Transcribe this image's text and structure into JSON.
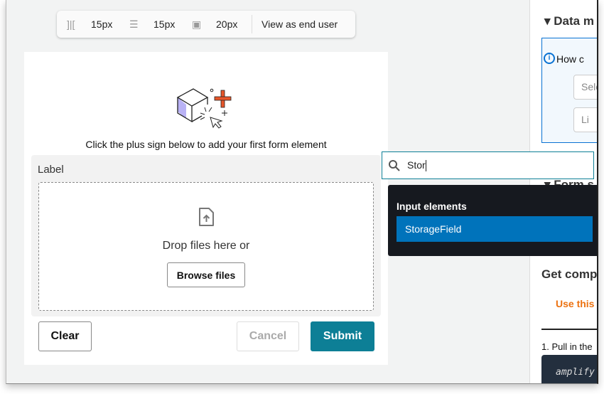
{
  "toolbar": {
    "items": [
      {
        "icon": "horizontal-gap-icon",
        "value": "15px"
      },
      {
        "icon": "vertical-gap-icon",
        "value": "15px"
      },
      {
        "icon": "padding-icon",
        "value": "20px"
      }
    ],
    "view_label": "View as end user"
  },
  "canvas": {
    "hint": "Click the plus sign below to add your first form element",
    "field": {
      "label": "Label",
      "drop_text": "Drop files here or",
      "browse_label": "Browse files"
    },
    "actions": {
      "clear": "Clear",
      "cancel": "Cancel",
      "submit": "Submit"
    }
  },
  "search": {
    "value": "Stor"
  },
  "menu": {
    "group": "Input elements",
    "options": [
      "StorageField"
    ]
  },
  "right_panel": {
    "data_heading": "Data m",
    "info_question": "How c",
    "select_placeholder": "Sele",
    "link_button": "Li",
    "form_heading": "Form s",
    "get_heading": "Get comp",
    "tab": "Use this c",
    "step": "1. Pull in the",
    "code": "amplify"
  },
  "colors": {
    "accent": "#0d7f96",
    "menu_bg": "#16191f",
    "highlight": "#0073bb",
    "tab_active": "#ec7211"
  }
}
